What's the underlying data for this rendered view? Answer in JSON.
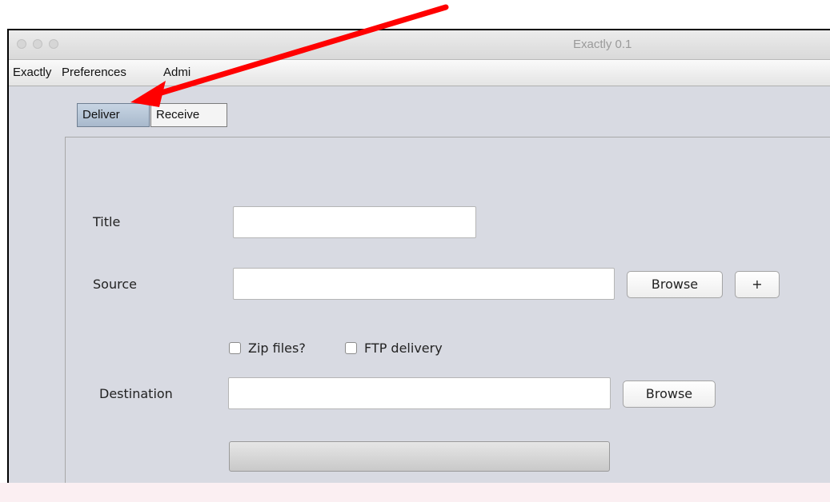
{
  "window": {
    "title": "Exactly 0.1"
  },
  "menubar": {
    "items": [
      "Exactly",
      "Preferences",
      "Admi"
    ]
  },
  "tabs": [
    {
      "label": "Deliver",
      "active": true
    },
    {
      "label": "Receive",
      "active": false
    }
  ],
  "form": {
    "title_label": "Title",
    "title_value": "",
    "source_label": "Source",
    "source_value": "",
    "source_browse_label": "Browse",
    "add_label": "+",
    "zip_label": "Zip files?",
    "zip_checked": false,
    "ftp_label": "FTP delivery",
    "ftp_checked": false,
    "destination_label": "Destination",
    "destination_value": "",
    "destination_browse_label": "Browse",
    "progress_fraction": 0
  },
  "colors": {
    "annotation_arrow": "#ff0000",
    "active_tab": "#b6c6d8",
    "panel_background": "#d8dae2"
  },
  "icons": {
    "annotation": "red-arrow-icon",
    "traffic_lights": [
      "close-icon",
      "minimize-icon",
      "zoom-icon"
    ]
  }
}
